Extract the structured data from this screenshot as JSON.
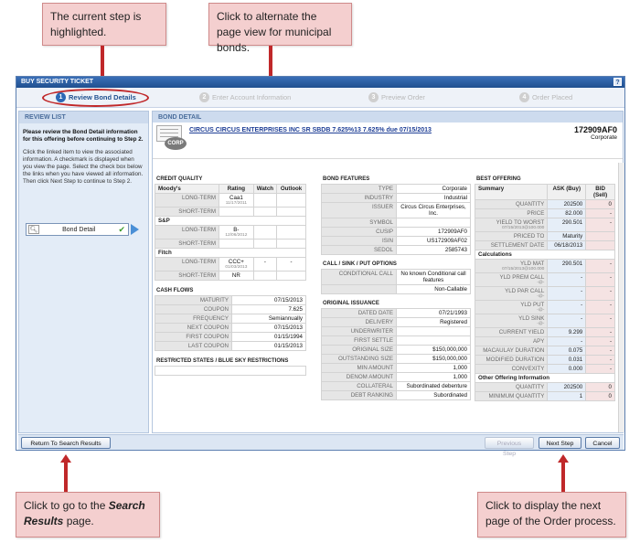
{
  "callouts": {
    "current_step": "The current step is highlighted.",
    "alternate_view": "Click to alternate the page view for municipal bonds.",
    "search_results_pre": "Click to go to the ",
    "search_results_em": "Search Results",
    "search_results_post": " page.",
    "next_page": "Click to display the next page of the Order process."
  },
  "window": {
    "title": "BUY SECURITY TICKET",
    "help": "?"
  },
  "steps": [
    {
      "num": "1",
      "label": "Review Bond Details"
    },
    {
      "num": "2",
      "label": "Enter Account Information"
    },
    {
      "num": "3",
      "label": "Preview Order"
    },
    {
      "num": "4",
      "label": "Order Placed"
    }
  ],
  "sidebar": {
    "header": "REVIEW LIST",
    "intro": "Please review the Bond Detail information for this offering before continuing to Step 2.",
    "help": "Click the linked item to view the associated information. A checkmark is displayed when you view the page. Select the check box below the links when you have viewed all information. Then click Next Step to continue to Step 2.",
    "item": "Bond Detail",
    "item_check": "✔"
  },
  "main": {
    "header": "BOND DETAIL",
    "badge": "CORP",
    "bond_title": "CIRCUS CIRCUS ENTERPRISES INC SR SBDB 7.625%13 7.625% due 07/15/2013",
    "cusip_head": "172909AF0",
    "type_head": "Corporate"
  },
  "credit_quality": {
    "title": "CREDIT QUALITY",
    "headers": [
      "Moody's",
      "Rating",
      "Watch",
      "Outlook"
    ],
    "moodys_label": "Moody's",
    "sp_label": "S&P",
    "fitch_label": "Fitch",
    "long_term": "LONG-TERM",
    "short_term": "SHORT-TERM",
    "moodys_lt": "Caa1",
    "moodys_lt_date": "11/17/2011",
    "sp_lt": "B-",
    "sp_lt_date": "12/06/2012",
    "fitch_lt": "CCC+",
    "fitch_lt_date": "01/03/2013",
    "fitch_lt_watch": "-",
    "fitch_lt_outlook": "-",
    "fitch_st": "NR"
  },
  "cash_flows": {
    "title": "CASH FLOWS",
    "rows": [
      {
        "label": "MATURITY",
        "value": "07/15/2013"
      },
      {
        "label": "COUPON",
        "value": "7.625"
      },
      {
        "label": "FREQUENCY",
        "value": "Semiannually"
      },
      {
        "label": "NEXT COUPON",
        "value": "07/15/2013"
      },
      {
        "label": "FIRST COUPON",
        "value": "01/15/1994"
      },
      {
        "label": "LAST COUPON",
        "value": "01/15/2013"
      }
    ]
  },
  "restricted": {
    "title": "RESTRICTED STATES / BLUE SKY RESTRICTIONS"
  },
  "bond_features": {
    "title": "BOND FEATURES",
    "rows": [
      {
        "label": "TYPE",
        "value": "Corporate"
      },
      {
        "label": "INDUSTRY",
        "value": "Industrial"
      },
      {
        "label": "ISSUER",
        "value": "Circus Circus Enterprises, Inc."
      },
      {
        "label": "SYMBOL",
        "value": ""
      },
      {
        "label": "CUSIP",
        "value": "172909AF0"
      },
      {
        "label": "ISIN",
        "value": "US172909AF02"
      },
      {
        "label": "SEDOL",
        "value": "2585743"
      }
    ]
  },
  "call_sink": {
    "title": "CALL / SINK / PUT OPTIONS",
    "label": "CONDITIONAL CALL",
    "value": "No known Conditional call features",
    "value2": "Non-Callable"
  },
  "original_issuance": {
    "title": "ORIGINAL ISSUANCE",
    "rows": [
      {
        "label": "DATED DATE",
        "value": "07/21/1993"
      },
      {
        "label": "DELIVERY",
        "value": "Registered"
      },
      {
        "label": "UNDERWRITER",
        "value": ""
      },
      {
        "label": "FIRST SETTLE",
        "value": ""
      },
      {
        "label": "ORIGINAL SIZE",
        "value": "$150,000,000"
      },
      {
        "label": "OUTSTANDING SIZE",
        "value": "$150,000,000"
      },
      {
        "label": "MIN AMOUNT",
        "value": "1,000"
      },
      {
        "label": "DENOM AMOUNT",
        "value": "1,000"
      },
      {
        "label": "COLLATERAL",
        "value": "Subordinated debenture"
      },
      {
        "label": "DEBT RANKING",
        "value": "Subordinated"
      }
    ]
  },
  "best_offering": {
    "title": "BEST OFFERING",
    "headers": [
      "Summary",
      "ASK (Buy)",
      "BID (Sell)"
    ],
    "summary_rows": [
      {
        "label": "QUANTITY",
        "sub": "",
        "ask": "202500",
        "bid": "0"
      },
      {
        "label": "PRICE",
        "sub": "",
        "ask": "82.000",
        "bid": "-"
      },
      {
        "label": "YIELD TO WORST",
        "sub": "07/15/2013@100.000",
        "ask": "290.501",
        "bid": "-"
      },
      {
        "label": "PRICED TO",
        "sub": "",
        "ask": "Maturity",
        "bid": ""
      },
      {
        "label": "SETTLEMENT DATE",
        "sub": "",
        "ask": "06/18/2013",
        "bid": ""
      }
    ],
    "calc_title": "Calculations",
    "calc_rows": [
      {
        "label": "YLD MAT",
        "sub": "07/15/2013@100.000",
        "ask": "290.501",
        "bid": "-"
      },
      {
        "label": "YLD PREM CALL",
        "sub": "-@-",
        "ask": "-",
        "bid": "-"
      },
      {
        "label": "YLD PAR CALL",
        "sub": "-@-",
        "ask": "-",
        "bid": "-"
      },
      {
        "label": "YLD PUT",
        "sub": "-@-",
        "ask": "-",
        "bid": "-"
      },
      {
        "label": "YLD SINK",
        "sub": "-@-",
        "ask": "-",
        "bid": "-"
      },
      {
        "label": "CURRENT YIELD",
        "sub": "",
        "ask": "9.299",
        "bid": "-"
      },
      {
        "label": "APY",
        "sub": "",
        "ask": "-",
        "bid": "-"
      },
      {
        "label": "MACAULAY DURATION",
        "sub": "",
        "ask": "0.075",
        "bid": "-"
      },
      {
        "label": "MODIFIED DURATION",
        "sub": "",
        "ask": "0.031",
        "bid": "-"
      },
      {
        "label": "CONVEXITY",
        "sub": "",
        "ask": "0.000",
        "bid": "-"
      }
    ],
    "other_title": "Other Offering Information",
    "other_rows": [
      {
        "label": "QUANTITY",
        "ask": "202500",
        "bid": "0"
      },
      {
        "label": "MINIMUM QUANTITY",
        "ask": "1",
        "bid": "0"
      }
    ]
  },
  "footer": {
    "return_label": "Return To Search Results",
    "prev_label": "Previous Step",
    "next_label": "Next Step",
    "cancel_label": "Cancel"
  }
}
